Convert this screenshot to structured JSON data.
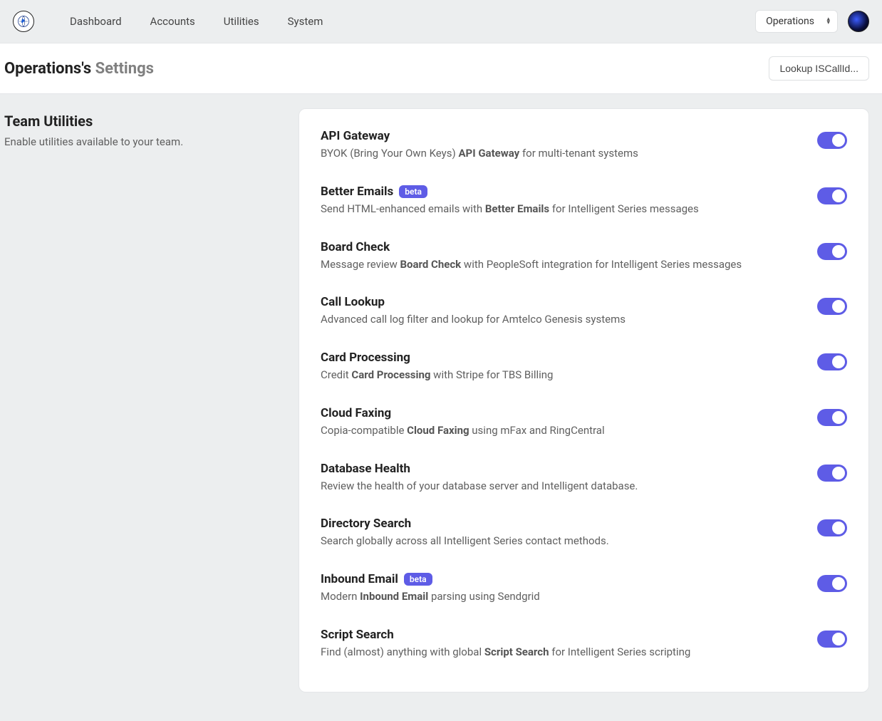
{
  "nav": {
    "links": [
      "Dashboard",
      "Accounts",
      "Utilities",
      "System"
    ],
    "team_selected": "Operations"
  },
  "header": {
    "title_prefix": "Operations's",
    "title_suffix": "Settings",
    "lookup_label": "Lookup ISCallId..."
  },
  "sidebar": {
    "title": "Team Utilities",
    "desc": "Enable utilities available to your team."
  },
  "badge_beta": "beta",
  "utilities": [
    {
      "title": "API Gateway",
      "badge": null,
      "desc_pre": "BYOK (Bring Your Own Keys) ",
      "desc_bold": "API Gateway",
      "desc_post": " for multi-tenant systems",
      "enabled": true
    },
    {
      "title": "Better Emails",
      "badge": "beta",
      "desc_pre": "Send HTML-enhanced emails with ",
      "desc_bold": "Better Emails",
      "desc_post": " for Intelligent Series messages",
      "enabled": true
    },
    {
      "title": "Board Check",
      "badge": null,
      "desc_pre": "Message review ",
      "desc_bold": "Board Check",
      "desc_post": " with PeopleSoft integration for Intelligent Series messages",
      "enabled": true
    },
    {
      "title": "Call Lookup",
      "badge": null,
      "desc_pre": "Advanced call log filter and lookup for Amtelco Genesis systems",
      "desc_bold": "",
      "desc_post": "",
      "enabled": true
    },
    {
      "title": "Card Processing",
      "badge": null,
      "desc_pre": "Credit ",
      "desc_bold": "Card Processing",
      "desc_post": " with Stripe for TBS Billing",
      "enabled": true
    },
    {
      "title": "Cloud Faxing",
      "badge": null,
      "desc_pre": "Copia-compatible ",
      "desc_bold": "Cloud Faxing",
      "desc_post": " using mFax and RingCentral",
      "enabled": true
    },
    {
      "title": "Database Health",
      "badge": null,
      "desc_pre": "Review the health of your database server and Intelligent database.",
      "desc_bold": "",
      "desc_post": "",
      "enabled": true
    },
    {
      "title": "Directory Search",
      "badge": null,
      "desc_pre": "Search globally across all Intelligent Series contact methods.",
      "desc_bold": "",
      "desc_post": "",
      "enabled": true
    },
    {
      "title": "Inbound Email",
      "badge": "beta",
      "desc_pre": "Modern ",
      "desc_bold": "Inbound Email",
      "desc_post": " parsing using Sendgrid",
      "enabled": true
    },
    {
      "title": "Script Search",
      "badge": null,
      "desc_pre": "Find (almost) anything with global ",
      "desc_bold": "Script Search",
      "desc_post": " for Intelligent Series scripting",
      "enabled": true
    }
  ]
}
